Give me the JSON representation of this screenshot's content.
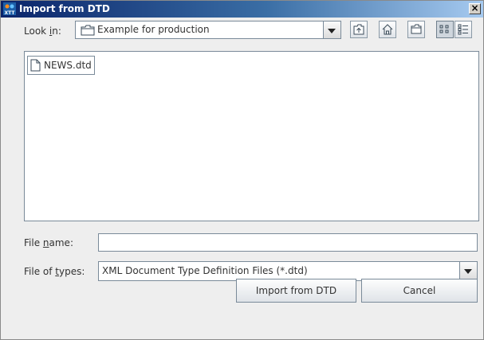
{
  "window": {
    "title": "Import from DTD",
    "close_glyph": "×"
  },
  "lookin": {
    "label_pre": "Look ",
    "label_key": "i",
    "label_post": "n:",
    "value": "Example for production"
  },
  "files": [
    {
      "name": "NEWS.dtd"
    }
  ],
  "filename": {
    "label_pre": "File ",
    "label_key": "n",
    "label_post": "ame:",
    "value": ""
  },
  "filetypes": {
    "label_pre": "File of ",
    "label_key": "t",
    "label_post": "ypes:",
    "value": "XML Document Type Definition Files (*.dtd)"
  },
  "buttons": {
    "import": "Import from DTD",
    "cancel": "Cancel"
  },
  "icons": [
    "app-logo-icon",
    "folder-icon",
    "up-folder-icon",
    "home-icon",
    "new-folder-icon",
    "list-view-icon",
    "details-view-icon",
    "file-icon",
    "chevron-down-icon",
    "close-icon"
  ]
}
